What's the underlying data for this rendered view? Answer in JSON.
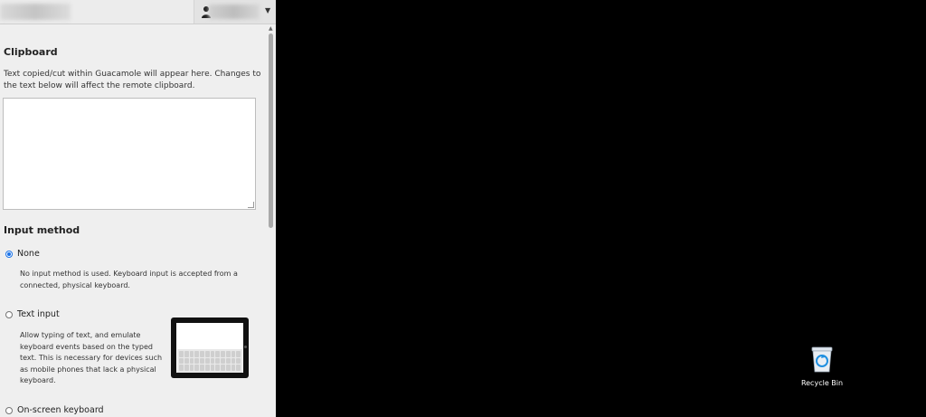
{
  "clipboard": {
    "heading": "Clipboard",
    "description": "Text copied/cut within Guacamole will appear here. Changes to the text below will affect the remote clipboard.",
    "value": ""
  },
  "input_method": {
    "heading": "Input method",
    "options": [
      {
        "label": "None",
        "selected": true,
        "description": "No input method is used. Keyboard input is accepted from a connected, physical keyboard."
      },
      {
        "label": "Text input",
        "selected": false,
        "description": "Allow typing of text, and emulate keyboard events based on the typed text. This is necessary for devices such as mobile phones that lack a physical keyboard."
      },
      {
        "label": "On-screen keyboard",
        "selected": false
      }
    ]
  },
  "desktop": {
    "icons": [
      {
        "label": "Recycle Bin",
        "icon": "recycle-bin-icon"
      }
    ]
  },
  "colors": {
    "desktop_bg": "#000000",
    "menu_bg": "#efefef",
    "accent": "#1a73e8"
  }
}
